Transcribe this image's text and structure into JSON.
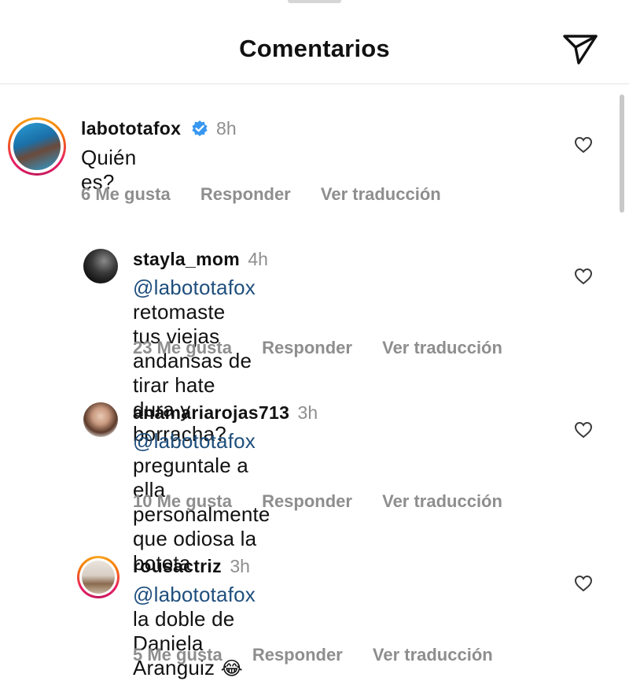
{
  "header": {
    "title": "Comentarios",
    "share_icon": "paper-plane-icon"
  },
  "comments": [
    {
      "username": "labototafox",
      "verified": true,
      "time": "8h",
      "text": "Quién es?",
      "likes": "6 Me gusta",
      "reply": "Responder",
      "translate": "Ver traducción",
      "avatar_ring": true
    },
    {
      "username": "stayla_mom",
      "time": "4h",
      "mention": "@labototafox",
      "text_line1": " retomaste tus viejas",
      "text_line2": "andansas de tirar hate dura y borracha?",
      "likes": "23 Me gusta",
      "reply": "Responder",
      "translate": "Ver traducción"
    },
    {
      "username": "anamariarojas713",
      "time": "3h",
      "mention": "@labototafox",
      "text_line1": " preguntale a ella",
      "text_line2": "personalmente que odiosa la botota",
      "likes": "10 Me gusta",
      "reply": "Responder",
      "translate": "Ver traducción"
    },
    {
      "username": "rousactriz",
      "time": "3h",
      "mention": "@labototafox",
      "text_line1": " la doble de Daniela",
      "text_line2": "Aranguiz",
      "emoji": "😂",
      "likes": "5 Me gusta",
      "reply": "Responder",
      "translate": "Ver traducción",
      "avatar_ring": true
    }
  ],
  "colors": {
    "mention": "#1f4f7d",
    "muted": "#8e8e8e",
    "verified": "#3897f0"
  }
}
